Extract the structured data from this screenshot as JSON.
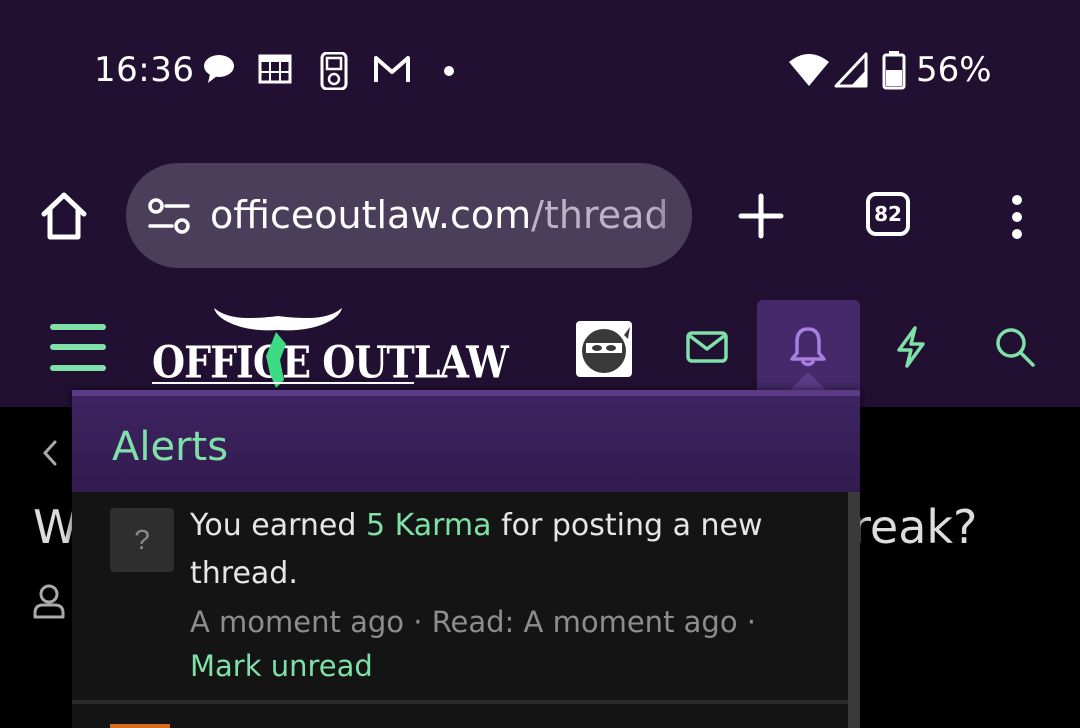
{
  "status": {
    "time": "16:36",
    "battery": "56%",
    "notification_icons": [
      "chat-bubble-icon",
      "calendar-grid-icon",
      "ipod-icon",
      "gmail-icon",
      "dot-icon"
    ],
    "system_icons": [
      "wifi-icon",
      "signal-icon",
      "battery-icon"
    ]
  },
  "browser": {
    "url_domain": "officeoutlaw.com",
    "url_path": "/thread",
    "tab_count": "82"
  },
  "site": {
    "logo_text": "OFFICE OUTLAW"
  },
  "page": {
    "title_left": "W",
    "title_right": "reak?"
  },
  "alerts": {
    "title": "Alerts",
    "items": [
      {
        "avatar": "?",
        "text_before": "You earned ",
        "highlight": "5 Karma",
        "text_after": " for posting a new thread.",
        "time": "A moment ago",
        "read_label": "Read: A moment ago",
        "separator": " · ",
        "action": "Mark unread"
      }
    ]
  },
  "colors": {
    "header_bg": "#211032",
    "accent_green": "#7fe0a8",
    "alerts_purple": "#3e2462"
  }
}
